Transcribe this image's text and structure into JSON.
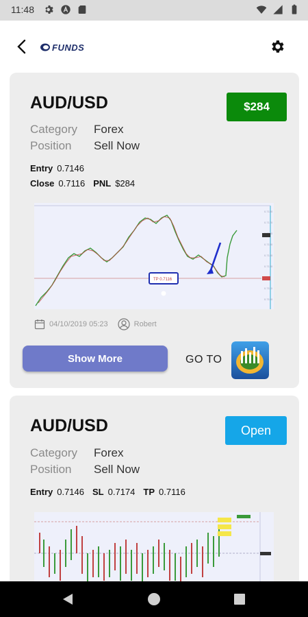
{
  "status_bar": {
    "time": "11:48",
    "left_icons": [
      "gear-icon",
      "a-circle-icon",
      "sd-card-icon"
    ],
    "right_icons": [
      "wifi-icon",
      "signal-icon",
      "battery-icon"
    ]
  },
  "header": {
    "back_icon": "chevron-left-icon",
    "logo_text": "FUNDS",
    "settings_icon": "gear-icon"
  },
  "cards": [
    {
      "pair": "AUD/USD",
      "pnl_badge": "$284",
      "badge_color": "#0b8a0b",
      "category_label": "Category",
      "category_value": "Forex",
      "position_label": "Position",
      "position_value": "Sell Now",
      "entry_label": "Entry",
      "entry_value": "0.7146",
      "close_label": "Close",
      "close_value": "0.7116",
      "pnl_label": "PNL",
      "pnl_value": "$284",
      "date": "04/10/2019 05:23",
      "author": "Robert",
      "show_more": "Show More",
      "goto_label": "GO TO",
      "goto_icon": "metatrader-icon"
    },
    {
      "pair": "AUD/USD",
      "status_badge": "Open",
      "badge_color": "#15a6e8",
      "category_label": "Category",
      "category_value": "Forex",
      "position_label": "Position",
      "position_value": "Sell Now",
      "entry_label": "Entry",
      "entry_value": "0.7146",
      "sl_label": "SL",
      "sl_value": "0.7174",
      "tp_label": "TP",
      "tp_value": "0.7116"
    }
  ],
  "nav_bar": {
    "icons": [
      "nav-back-icon",
      "nav-home-icon",
      "nav-recents-icon"
    ]
  }
}
